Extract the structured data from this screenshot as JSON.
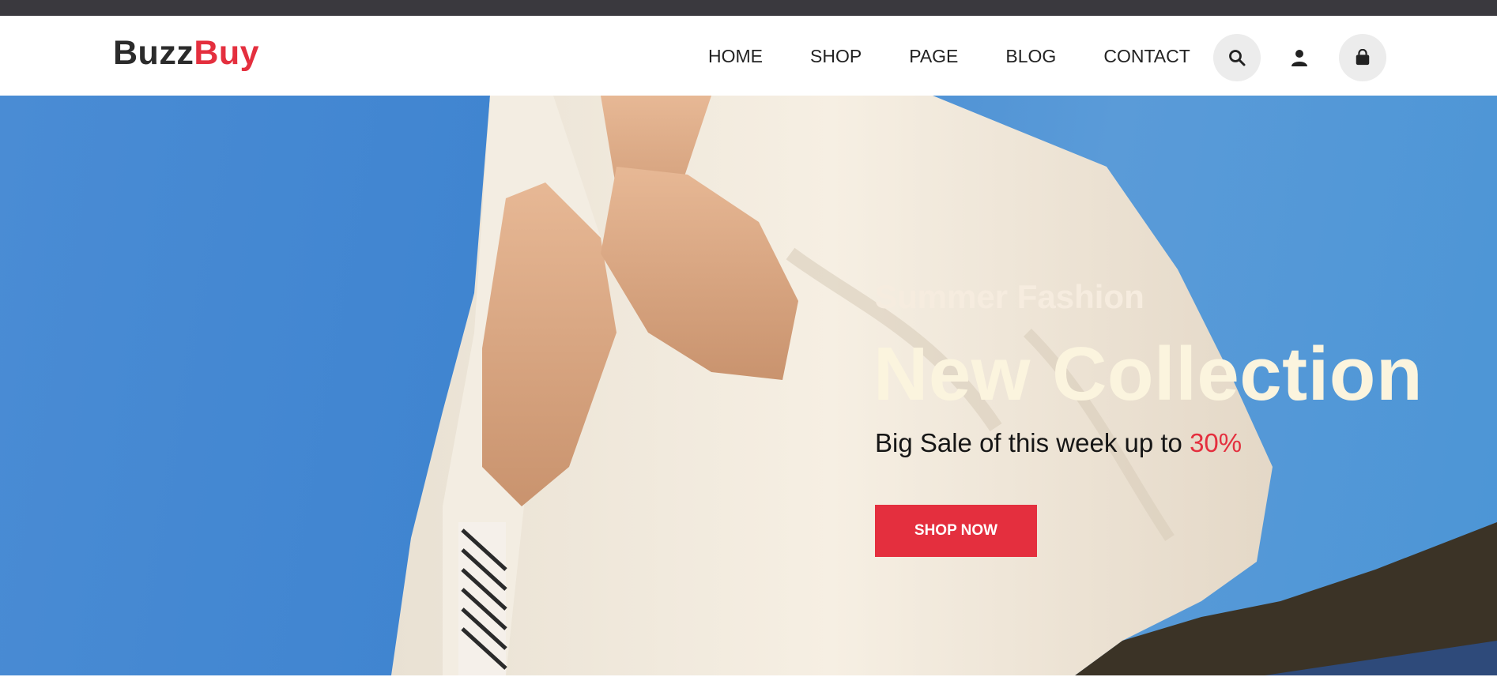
{
  "brand": {
    "part1": "Buzz",
    "part2": "Buy",
    "accent_color": "#e42f3e"
  },
  "nav": {
    "items": [
      {
        "label": "HOME"
      },
      {
        "label": "SHOP"
      },
      {
        "label": "PAGE"
      },
      {
        "label": "BLOG"
      },
      {
        "label": "CONTACT"
      }
    ]
  },
  "header_icons": [
    "search-icon",
    "user-icon",
    "shopping-bag-icon"
  ],
  "hero": {
    "subtitle": "Summer Fashion",
    "title": "New Collection",
    "sale_text": "Big Sale of this week up to ",
    "sale_percent": "30%",
    "cta_label": "SHOP NOW",
    "background": "photo of person in white shirt against blue sky"
  }
}
